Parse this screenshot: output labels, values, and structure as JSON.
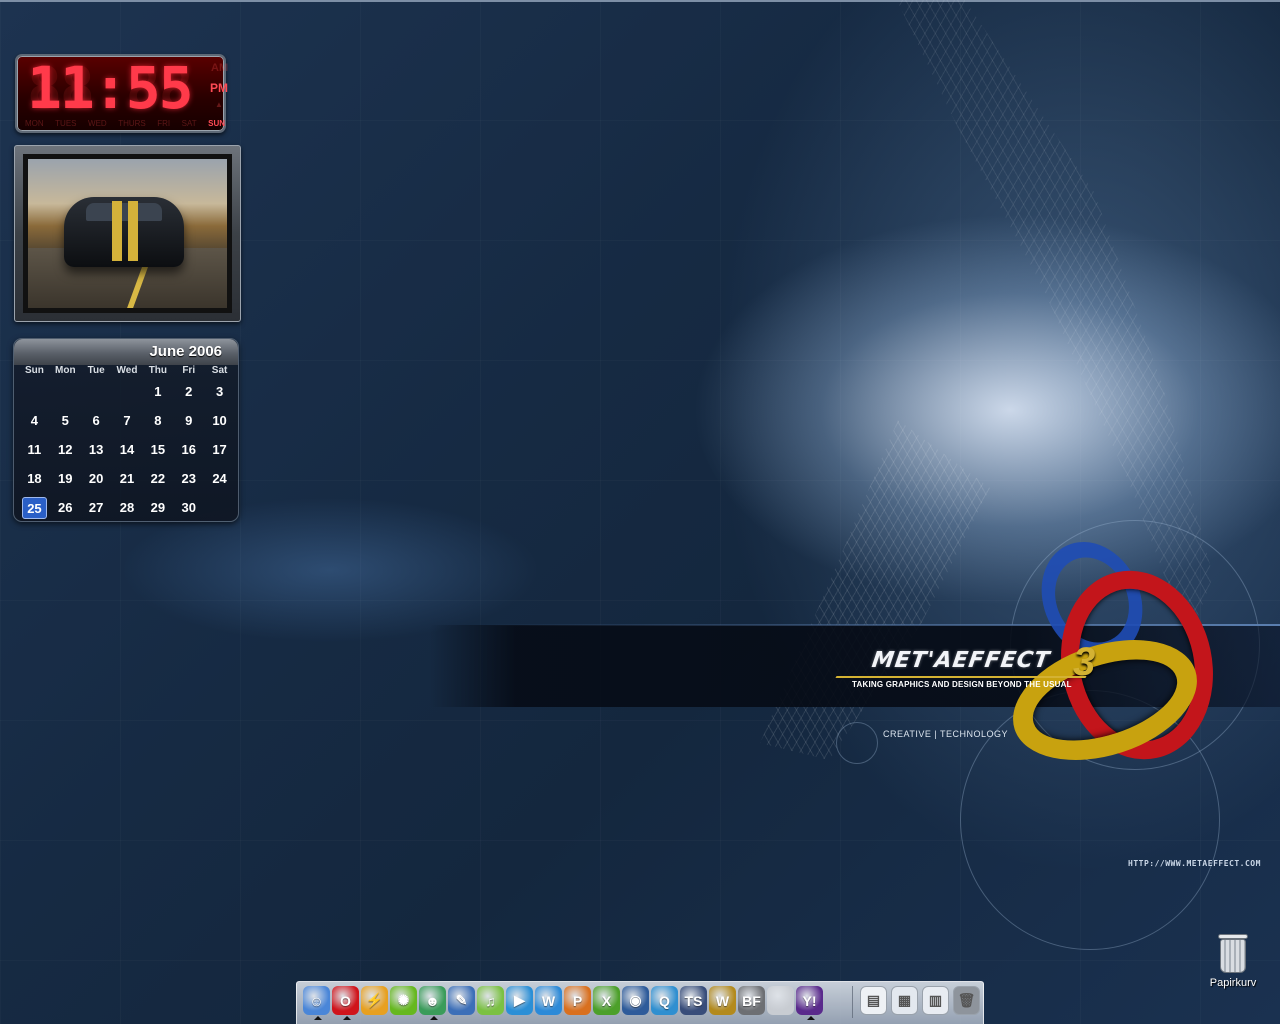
{
  "clock": {
    "time": "11:55",
    "ghost": "88:88",
    "am_label": "AM",
    "pm_label": "PM",
    "days": [
      "MON",
      "TUES",
      "WED",
      "THURS",
      "FRI",
      "SAT",
      "SUN"
    ],
    "active_day": "SUN"
  },
  "calendar": {
    "month_title": "June 2006",
    "weekdays": [
      "Sun",
      "Mon",
      "Tue",
      "Wed",
      "Thu",
      "Fri",
      "Sat"
    ],
    "days": [
      "",
      "",
      "",
      "",
      "1",
      "2",
      "3",
      "4",
      "5",
      "6",
      "7",
      "8",
      "9",
      "10",
      "11",
      "12",
      "13",
      "14",
      "15",
      "16",
      "17",
      "18",
      "19",
      "20",
      "21",
      "22",
      "23",
      "24",
      "25",
      "26",
      "27",
      "28",
      "29",
      "30",
      ""
    ],
    "today": "25",
    "today_color": "#2a5fc7"
  },
  "wallpaper": {
    "logo_title": "MET'AEFFECT",
    "logo_number": "3",
    "tagline": "TAKING GRAPHICS AND DESIGN BEYOND THE USUAL",
    "subtitle": "CREATIVE | TECHNOLOGY",
    "website": "HTTP://WWW.METAEFFECT.COM"
  },
  "recycle_bin": {
    "label": "Papirkurv",
    "icon": "recycle-bin-icon"
  },
  "dock": {
    "apps": [
      {
        "name": "finder-icon",
        "glyph": "☺",
        "color": "#4a86d8",
        "running": true
      },
      {
        "name": "opera-icon",
        "glyph": "O",
        "color": "#d0141b",
        "running": true
      },
      {
        "name": "winamp-icon",
        "glyph": "⚡",
        "color": "#e7a020",
        "running": false
      },
      {
        "name": "chat-icon",
        "glyph": "✺",
        "color": "#66b81f",
        "running": false
      },
      {
        "name": "messenger-icon",
        "glyph": "☻",
        "color": "#3a9c5a",
        "running": true
      },
      {
        "name": "photo-editor-icon",
        "glyph": "✎",
        "color": "#3c6fb8",
        "running": false
      },
      {
        "name": "music-icon",
        "glyph": "♫",
        "color": "#7bc142",
        "running": false
      },
      {
        "name": "media-player-icon",
        "glyph": "▶",
        "color": "#2b8fd6",
        "running": false
      },
      {
        "name": "word-icon",
        "glyph": "W",
        "color": "#2c8ad8",
        "running": false
      },
      {
        "name": "powerpoint-icon",
        "glyph": "P",
        "color": "#d9701f",
        "running": false
      },
      {
        "name": "excel-icon",
        "glyph": "X",
        "color": "#4ca02a",
        "running": false
      },
      {
        "name": "dvd-player-icon",
        "glyph": "◉",
        "color": "#2e5b9a",
        "running": false
      },
      {
        "name": "search-icon",
        "glyph": "Q",
        "color": "#2f8fd0",
        "running": false
      },
      {
        "name": "teamspeak-icon",
        "glyph": "TS",
        "color": "#384d7a",
        "running": false
      },
      {
        "name": "warcraft-icon",
        "glyph": "W",
        "color": "#b38a1d",
        "running": false
      },
      {
        "name": "battlefield-icon",
        "glyph": "BF",
        "color": "#6d6f73",
        "running": false
      },
      {
        "name": "apple-icon",
        "glyph": "",
        "color": "#c8ccd2",
        "running": false
      },
      {
        "name": "yahoo-icon",
        "glyph": "Y!",
        "color": "#5a2a8c",
        "running": true
      }
    ],
    "docs": [
      {
        "name": "document-icon",
        "glyph": "▤",
        "color": "#eef1f5"
      },
      {
        "name": "windows-explorer-icon",
        "glyph": "▦",
        "color": "#e3e8ef"
      },
      {
        "name": "webpage-icon",
        "glyph": "▥",
        "color": "#e8ecf2"
      },
      {
        "name": "trash-icon",
        "glyph": "🗑",
        "color": "#8e949c"
      }
    ]
  }
}
